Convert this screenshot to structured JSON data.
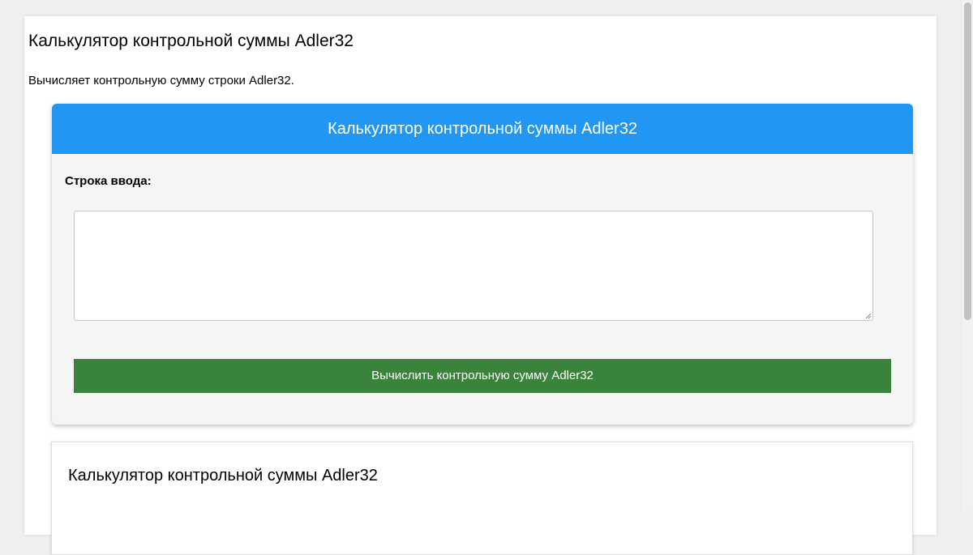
{
  "page": {
    "title": "Калькулятор контрольной суммы Adler32",
    "description": "Вычисляет контрольную сумму строки Adler32."
  },
  "calculator": {
    "header": "Калькулятор контрольной суммы Adler32",
    "input_label": "Строка ввода:",
    "input_value": "",
    "button_label": "Вычислить контрольную сумму Adler32"
  },
  "info_card": {
    "title": "Калькулятор контрольной суммы Adler32"
  },
  "colors": {
    "accent": "#2196f3",
    "button": "#3a833a",
    "background": "#f0f0f0",
    "card_background": "#f5f5f5"
  },
  "icons": {
    "resize_handle": "resize-grip-icon"
  }
}
